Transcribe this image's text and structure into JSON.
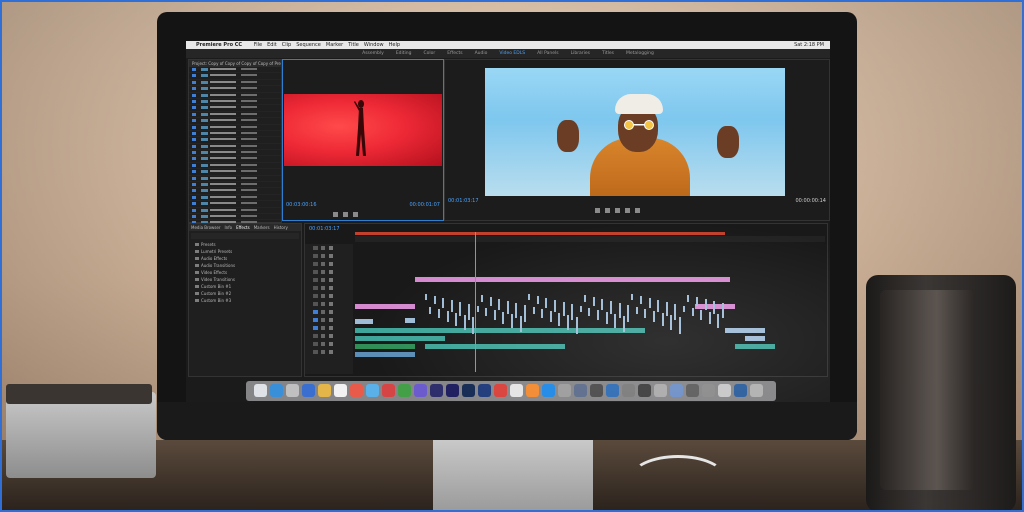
{
  "menubar": {
    "app": "Premiere Pro CC",
    "items": [
      "File",
      "Edit",
      "Clip",
      "Sequence",
      "Marker",
      "Title",
      "Window",
      "Help"
    ],
    "clock": "Sat 2:18 PM"
  },
  "workspaces": {
    "items": [
      "Assembly",
      "Editing",
      "Color",
      "Effects",
      "Audio",
      "Video EDLS",
      "All Panels",
      "Libraries",
      "Titles",
      "Metalogging"
    ],
    "active_index": 5
  },
  "project_panel": {
    "tab_label": "Project: Copy of Copy of Copy of Copy of Pre Frtl"
  },
  "source_monitor": {
    "timecode_left": "00:03:00:16",
    "timecode_right": "00:00:01:07"
  },
  "program_monitor": {
    "timecode_left": "00:01:03:17",
    "timecode_right": "00:00:00:14"
  },
  "effects_panel": {
    "tabs": [
      "Media Browser",
      "Info",
      "Effects",
      "Markers",
      "History"
    ],
    "items": [
      "Presets",
      "Lumetri Presets",
      "Audio Effects",
      "Audio Transitions",
      "Video Effects",
      "Video Transitions",
      "Custom Bin #1",
      "Custom Bin #2",
      "Custom Bin #3"
    ]
  },
  "timeline": {
    "timecode": "00:01:03:17"
  },
  "colors": {
    "accent": "#4aa3ff",
    "source_red": "#ee2936",
    "program_sky": "#8fd0f2",
    "clip_pink": "#d58ad0",
    "clip_teal": "#3fa59a"
  }
}
